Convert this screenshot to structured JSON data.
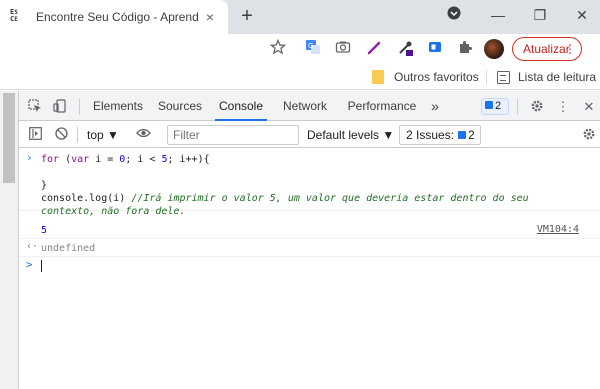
{
  "tab": {
    "favicon": "ES\nCE",
    "title": "Encontre Seu Código - Aprenda",
    "close": "×",
    "new_tab": "+"
  },
  "window": {
    "minimize": "—",
    "restore": "❐",
    "close": "✕"
  },
  "toolbar": {
    "update_label": "Atualizar",
    "update_dots": "⋮",
    "icons": [
      "star-icon",
      "translate-icon",
      "camera-icon",
      "pen-icon",
      "eyedropper-icon",
      "extension-card-icon",
      "puzzle-icon",
      "avatar"
    ]
  },
  "bookmarks": {
    "folder_label": "Outros favoritos",
    "reading_label": "Lista de leitura"
  },
  "devtools": {
    "tabs": [
      "Elements",
      "Sources",
      "Console",
      "Network",
      "Performance"
    ],
    "active_tab": "Console",
    "more_tabs": "»",
    "issue_count": "2",
    "context": "top",
    "filter_placeholder": "Filter",
    "levels": "Default levels ▼",
    "issues_label": "2 Issues:",
    "issues_count": "2"
  },
  "console": {
    "line1": "for (var i = 0; i < 5; i++){",
    "line2": "}",
    "line3_code": "console.log(i) ",
    "line3_comment": "//Irá imprimir o valor 5, um valor que deveria estar dentro do seu",
    "line4_comment": "contexto, não fora dele.",
    "output_value": "5",
    "output_source": "VM104:4",
    "return_value": "undefined",
    "input_prompt": ">"
  },
  "colors": {
    "accent": "#1a73e8",
    "update_red": "#d93025",
    "comment_green": "#236e25",
    "keyword": "#881280"
  }
}
